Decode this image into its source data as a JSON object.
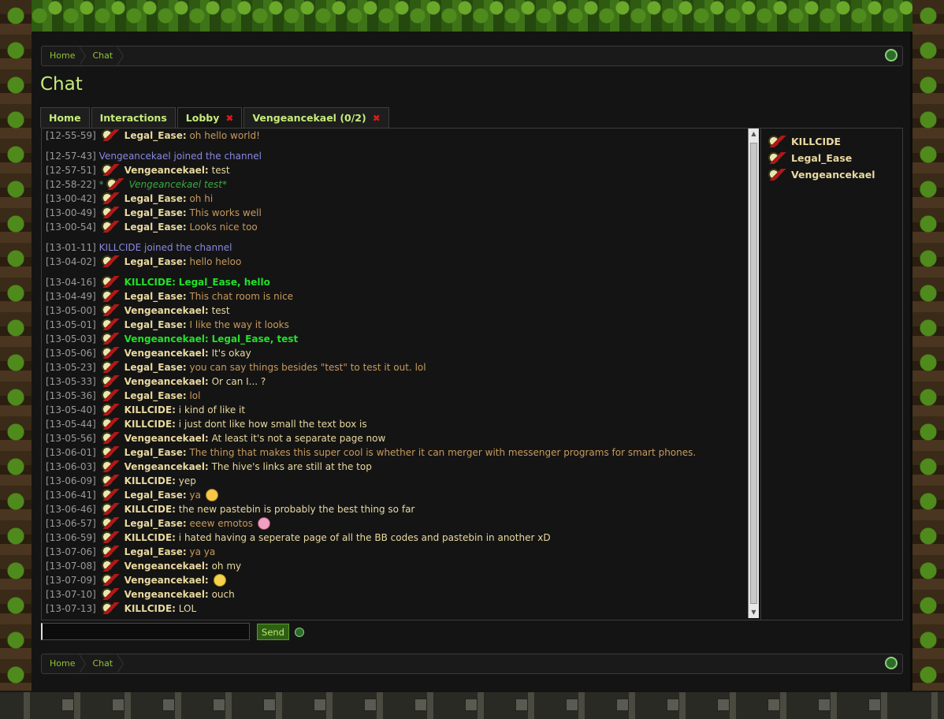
{
  "breadcrumb": [
    "Home",
    "Chat"
  ],
  "page_title": "Chat",
  "tabs": [
    {
      "label": "Home",
      "closable": false
    },
    {
      "label": "Interactions",
      "closable": false
    },
    {
      "label": "Lobby",
      "closable": true
    },
    {
      "label": "Vengeancekael (0/2)",
      "closable": true
    }
  ],
  "tab_close_glyph": "✖",
  "messages": [
    {
      "ts": "[12-55-59]",
      "type": "msg",
      "nick": "Legal_Ease:",
      "text": "oh hello world!",
      "style": "le"
    },
    {
      "ts": "[12-57-43]",
      "type": "system",
      "text": "Vengeancekael joined the channel",
      "gap": true
    },
    {
      "ts": "[12-57-51]",
      "type": "msg",
      "nick": "Vengeancekael:",
      "text": "test",
      "style": "w"
    },
    {
      "ts": "[12-58-22]",
      "type": "action",
      "text": "Vengeancekael test"
    },
    {
      "ts": "[13-00-42]",
      "type": "msg",
      "nick": "Legal_Ease:",
      "text": "oh hi",
      "style": "le"
    },
    {
      "ts": "[13-00-49]",
      "type": "msg",
      "nick": "Legal_Ease:",
      "text": "This works well",
      "style": "le"
    },
    {
      "ts": "[13-00-54]",
      "type": "msg",
      "nick": "Legal_Ease:",
      "text": "Looks nice too",
      "style": "le"
    },
    {
      "ts": "[13-01-11]",
      "type": "system",
      "text": "KILLCIDE joined the channel",
      "gap": true
    },
    {
      "ts": "[13-04-02]",
      "type": "msg",
      "nick": "Legal_Ease:",
      "text": "hello heloo",
      "style": "le"
    },
    {
      "ts": "[13-04-16]",
      "type": "msg",
      "nick": "KILLCIDE:",
      "text": "Legal_Ease, hello",
      "style": "hl",
      "gap": true
    },
    {
      "ts": "[13-04-49]",
      "type": "msg",
      "nick": "Legal_Ease:",
      "text": "This chat room is nice",
      "style": "le"
    },
    {
      "ts": "[13-05-00]",
      "type": "msg",
      "nick": "Vengeancekael:",
      "text": "test",
      "style": "w"
    },
    {
      "ts": "[13-05-01]",
      "type": "msg",
      "nick": "Legal_Ease:",
      "text": "I like the way it looks",
      "style": "le"
    },
    {
      "ts": "[13-05-03]",
      "type": "msg",
      "nick": "Vengeancekael:",
      "text": "Legal_Ease, test",
      "style": "hl"
    },
    {
      "ts": "[13-05-06]",
      "type": "msg",
      "nick": "Vengeancekael:",
      "text": "It's okay",
      "style": "w"
    },
    {
      "ts": "[13-05-23]",
      "type": "msg",
      "nick": "Legal_Ease:",
      "text": "you can say things besides \"test\" to test it out. lol",
      "style": "le"
    },
    {
      "ts": "[13-05-33]",
      "type": "msg",
      "nick": "Vengeancekael:",
      "text": "Or can I... ?",
      "style": "w"
    },
    {
      "ts": "[13-05-36]",
      "type": "msg",
      "nick": "Legal_Ease:",
      "text": "lol",
      "style": "le"
    },
    {
      "ts": "[13-05-40]",
      "type": "msg",
      "nick": "KILLCIDE:",
      "text": "i kind of like it",
      "style": "w"
    },
    {
      "ts": "[13-05-44]",
      "type": "msg",
      "nick": "KILLCIDE:",
      "text": "i just dont like how small the text box is",
      "style": "w"
    },
    {
      "ts": "[13-05-56]",
      "type": "msg",
      "nick": "Vengeancekael:",
      "text": "At least it's not a separate page now",
      "style": "w"
    },
    {
      "ts": "[13-06-01]",
      "type": "msg",
      "nick": "Legal_Ease:",
      "text": "The thing that makes this super cool is whether it can merger with messenger programs for smart phones.",
      "style": "le"
    },
    {
      "ts": "[13-06-03]",
      "type": "msg",
      "nick": "Vengeancekael:",
      "text": "The hive's links are still at the top",
      "style": "w"
    },
    {
      "ts": "[13-06-09]",
      "type": "msg",
      "nick": "KILLCIDE:",
      "text": "yep",
      "style": "w"
    },
    {
      "ts": "[13-06-41]",
      "type": "msg",
      "nick": "Legal_Ease:",
      "text": "ya",
      "style": "le",
      "emote": "sad"
    },
    {
      "ts": "[13-06-46]",
      "type": "msg",
      "nick": "KILLCIDE:",
      "text": "the new pastebin is probably the best thing so far",
      "style": "w"
    },
    {
      "ts": "[13-06-57]",
      "type": "msg",
      "nick": "Legal_Ease:",
      "text": "eeew emotos",
      "style": "le",
      "emote": "tongue"
    },
    {
      "ts": "[13-06-59]",
      "type": "msg",
      "nick": "KILLCIDE:",
      "text": "i hated having a seperate page of all the BB codes and pastebin in another xD",
      "style": "w"
    },
    {
      "ts": "[13-07-06]",
      "type": "msg",
      "nick": "Legal_Ease:",
      "text": "ya ya",
      "style": "le"
    },
    {
      "ts": "[13-07-08]",
      "type": "msg",
      "nick": "Vengeancekael:",
      "text": "oh my",
      "style": "w"
    },
    {
      "ts": "[13-07-09]",
      "type": "msg",
      "nick": "Vengeancekael:",
      "text": "",
      "style": "w",
      "emote": "smile"
    },
    {
      "ts": "[13-07-10]",
      "type": "msg",
      "nick": "Vengeancekael:",
      "text": "ouch",
      "style": "w"
    },
    {
      "ts": "[13-07-13]",
      "type": "msg",
      "nick": "KILLCIDE:",
      "text": "LOL",
      "style": "w"
    }
  ],
  "users": [
    "KILLCIDE",
    "Legal_Ease",
    "Vengeancekael"
  ],
  "input": {
    "value": "",
    "placeholder": ""
  },
  "send_label": "Send",
  "colors": {
    "accent": "#c5ec7a",
    "link": "#8fc23a",
    "highlight": "#22e02a",
    "system": "#8888e0",
    "legal_ease_text": "#c89a5c",
    "nick": "#e9d9a0",
    "close_x": "#d81c1c"
  }
}
